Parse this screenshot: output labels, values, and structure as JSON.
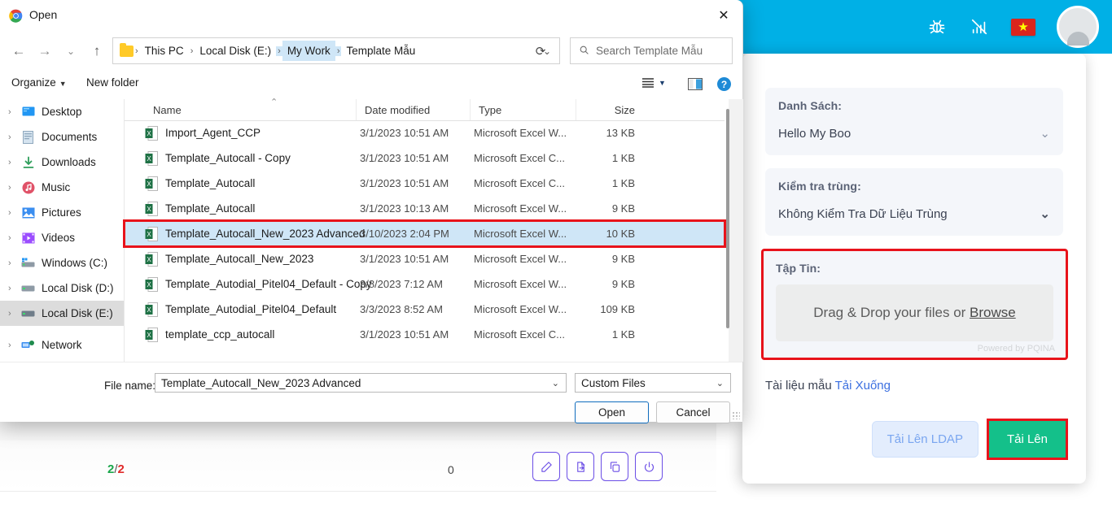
{
  "app_header": {
    "icons": [
      {
        "name": "bug-icon",
        "glyph": "bug"
      },
      {
        "name": "signal-off-icon",
        "glyph": "signal-off"
      },
      {
        "name": "vietnam-flag-icon",
        "glyph": "★"
      },
      {
        "name": "avatar",
        "glyph": "user"
      }
    ],
    "background_color": "#00b0e6"
  },
  "background_page": {
    "counter": {
      "current": "2",
      "separator": "/",
      "total": "2"
    },
    "zero_cell": "0",
    "row_actions": [
      {
        "name": "edit-action-icon",
        "glyph": "pencil"
      },
      {
        "name": "export-action-icon",
        "glyph": "file-export"
      },
      {
        "name": "copy-action-icon",
        "glyph": "copy"
      },
      {
        "name": "power-action-icon",
        "glyph": "power"
      }
    ]
  },
  "right_modal": {
    "list_field": {
      "label": "Danh Sách:",
      "value": "Hello My Boo",
      "chevron": "⌄"
    },
    "dup_field": {
      "label": "Kiểm tra trùng:",
      "value": "Không Kiểm Tra Dữ Liệu Trùng",
      "chevron": "⌄"
    },
    "file_field": {
      "label": "Tập Tin:",
      "dropzone_text": "Drag & Drop your files or ",
      "browse_label": "Browse",
      "powered_by": "Powered by PQINA",
      "highlight_color": "#e8131b"
    },
    "sample_doc": {
      "text": "Tài liệu mẫu ",
      "link_label": "Tải Xuống"
    },
    "buttons": {
      "ldap_label": "Tải Lên LDAP",
      "upload_label": "Tải Lên",
      "upload_color": "#14c08a",
      "upload_highlight_color": "#e8131b"
    }
  },
  "dialog": {
    "title": "Open",
    "close_label": "✕",
    "nav": {
      "back": "←",
      "forward": "→",
      "recent": "⌄",
      "up": "↑"
    },
    "breadcrumb": {
      "items": [
        "This PC",
        "Local Disk (E:)",
        "My Work",
        "Template Mẫu"
      ],
      "selected_index": 2,
      "chevron": "⌄"
    },
    "refresh_label": "⟳",
    "search": {
      "placeholder": "Search Template Mẫu",
      "icon": "search-icon"
    },
    "commandbar": {
      "organize_label": "Organize",
      "organize_caret": "▼",
      "new_folder_label": "New folder",
      "view_caret": "▼",
      "help_label": "?"
    },
    "tree": {
      "items": [
        {
          "label": "Desktop",
          "icon": "desktop-icon",
          "caret": "›",
          "selected": false
        },
        {
          "label": "Documents",
          "icon": "documents-icon",
          "caret": "›",
          "selected": false
        },
        {
          "label": "Downloads",
          "icon": "downloads-icon",
          "caret": "›",
          "selected": false
        },
        {
          "label": "Music",
          "icon": "music-icon",
          "caret": "›",
          "selected": false
        },
        {
          "label": "Pictures",
          "icon": "pictures-icon",
          "caret": "›",
          "selected": false
        },
        {
          "label": "Videos",
          "icon": "videos-icon",
          "caret": "›",
          "selected": false
        },
        {
          "label": "Windows (C:)",
          "icon": "drive-windows-icon",
          "caret": "›",
          "selected": false
        },
        {
          "label": "Local Disk (D:)",
          "icon": "drive-icon",
          "caret": "›",
          "selected": false
        },
        {
          "label": "Local Disk (E:)",
          "icon": "drive-icon",
          "caret": "›",
          "selected": true
        },
        {
          "label": "Network",
          "icon": "network-icon",
          "caret": "›",
          "selected": false
        }
      ]
    },
    "filelist": {
      "columns": [
        "Name",
        "Date modified",
        "Type",
        "Size"
      ],
      "sort_caret": "⌃",
      "rows": [
        {
          "name": "Import_Agent_CCP",
          "date": "3/1/2023 10:51 AM",
          "type": "Microsoft Excel W...",
          "size": "13 KB",
          "selected": false,
          "highlighted": false
        },
        {
          "name": "Template_Autocall - Copy",
          "date": "3/1/2023 10:51 AM",
          "type": "Microsoft Excel C...",
          "size": "1 KB",
          "selected": false,
          "highlighted": false
        },
        {
          "name": "Template_Autocall",
          "date": "3/1/2023 10:51 AM",
          "type": "Microsoft Excel C...",
          "size": "1 KB",
          "selected": false,
          "highlighted": false
        },
        {
          "name": "Template_Autocall",
          "date": "3/1/2023 10:13 AM",
          "type": "Microsoft Excel W...",
          "size": "9 KB",
          "selected": false,
          "highlighted": false
        },
        {
          "name": "Template_Autocall_New_2023 Advanced",
          "date": "3/10/2023 2:04 PM",
          "type": "Microsoft Excel W...",
          "size": "10 KB",
          "selected": true,
          "highlighted": true
        },
        {
          "name": "Template_Autocall_New_2023",
          "date": "3/1/2023 10:51 AM",
          "type": "Microsoft Excel W...",
          "size": "9 KB",
          "selected": false,
          "highlighted": false
        },
        {
          "name": "Template_Autodial_Pitel04_Default - Copy",
          "date": "3/8/2023 7:12 AM",
          "type": "Microsoft Excel W...",
          "size": "9 KB",
          "selected": false,
          "highlighted": false
        },
        {
          "name": "Template_Autodial_Pitel04_Default",
          "date": "3/3/2023 8:52 AM",
          "type": "Microsoft Excel W...",
          "size": "109 KB",
          "selected": false,
          "highlighted": false
        },
        {
          "name": "template_ccp_autocall",
          "date": "3/1/2023 10:51 AM",
          "type": "Microsoft Excel C...",
          "size": "1 KB",
          "selected": false,
          "highlighted": false
        }
      ]
    },
    "footer": {
      "filename_label": "File name:",
      "filename_value": "Template_Autocall_New_2023 Advanced",
      "filename_chevron": "⌄",
      "filter_value": "Custom Files",
      "filter_chevron": "⌄",
      "open_label": "Open",
      "cancel_label": "Cancel"
    }
  }
}
